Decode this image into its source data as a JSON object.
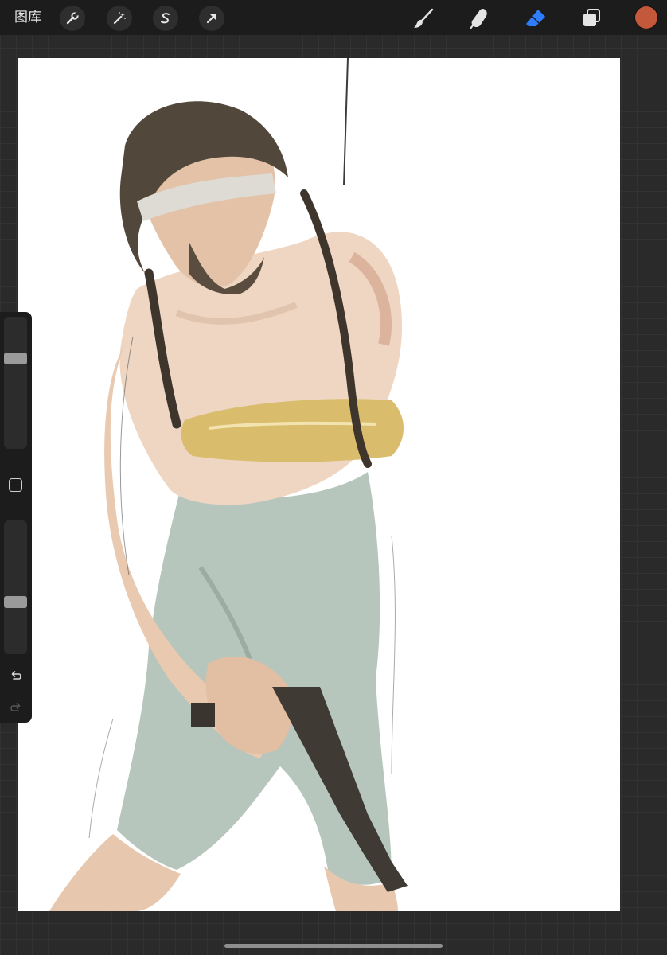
{
  "toolbar": {
    "gallery_label": "图库",
    "tools_left": [
      {
        "name": "actions",
        "icon": "wrench-icon"
      },
      {
        "name": "adjustments",
        "icon": "magic-wand-icon"
      },
      {
        "name": "selection",
        "icon": "selection-s-icon"
      },
      {
        "name": "transform",
        "icon": "arrow-cursor-icon"
      }
    ],
    "tools_right": [
      {
        "name": "brush",
        "icon": "brush-icon",
        "active": false
      },
      {
        "name": "smudge",
        "icon": "smudge-finger-icon",
        "active": false
      },
      {
        "name": "eraser",
        "icon": "eraser-icon",
        "active": true
      },
      {
        "name": "layers",
        "icon": "layers-icon",
        "active": false
      }
    ],
    "active_color": "#c4583a",
    "active_tool_color": "#2f7dff"
  },
  "sidebar": {
    "brush_size_level": 0.7,
    "opacity_level": 0.38,
    "modify_icon": "square-modifier-icon",
    "undo_icon": "undo-icon",
    "redo_icon": "redo-icon"
  },
  "canvas": {
    "artwork": "figure-sketch-artwork"
  }
}
